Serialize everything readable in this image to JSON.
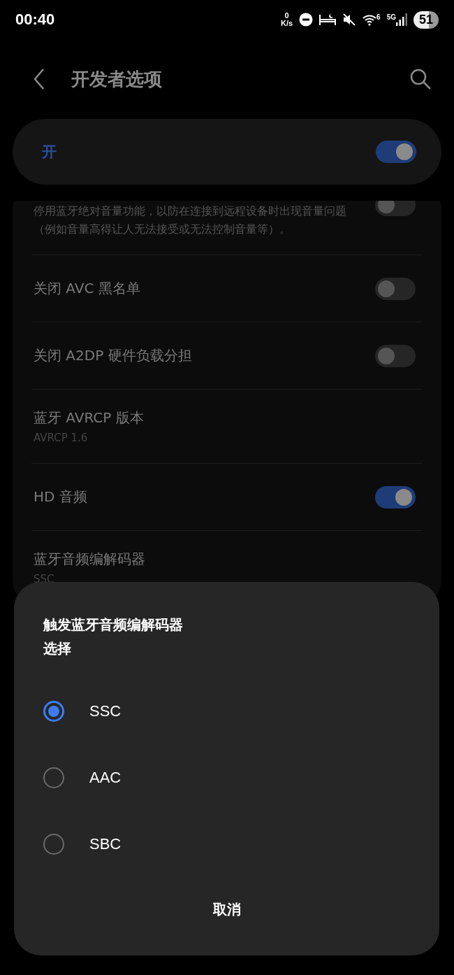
{
  "status_bar": {
    "time": "00:40",
    "net_speed_value": "0",
    "net_speed_unit": "K/s",
    "wifi_badge": "6",
    "signal_label": "5G",
    "battery": "51"
  },
  "app_bar": {
    "title": "开发者选项"
  },
  "master_switch": {
    "label": "开",
    "on": true
  },
  "settings": [
    {
      "kind": "toggle",
      "summary": "停用蓝牙绝对音量功能，以防在连接到远程设备时出现音量问题（例如音量高得让人无法接受或无法控制音量等）。",
      "on": false
    },
    {
      "kind": "toggle",
      "title": "关闭 AVC 黑名单",
      "on": false
    },
    {
      "kind": "toggle",
      "title": "关闭 A2DP 硬件负载分担",
      "on": false
    },
    {
      "kind": "value",
      "title": "蓝牙 AVRCP 版本",
      "summary": "AVRCP 1.6"
    },
    {
      "kind": "toggle",
      "title": "HD 音频",
      "on": true
    },
    {
      "kind": "value",
      "title": "蓝牙音频编解码器",
      "summary": "SSC"
    }
  ],
  "dialog": {
    "title": "触发蓝牙音频编解码器选择",
    "options": [
      {
        "label": "SSC",
        "selected": true
      },
      {
        "label": "AAC",
        "selected": false
      },
      {
        "label": "SBC",
        "selected": false
      }
    ],
    "cancel_button": "取消"
  }
}
